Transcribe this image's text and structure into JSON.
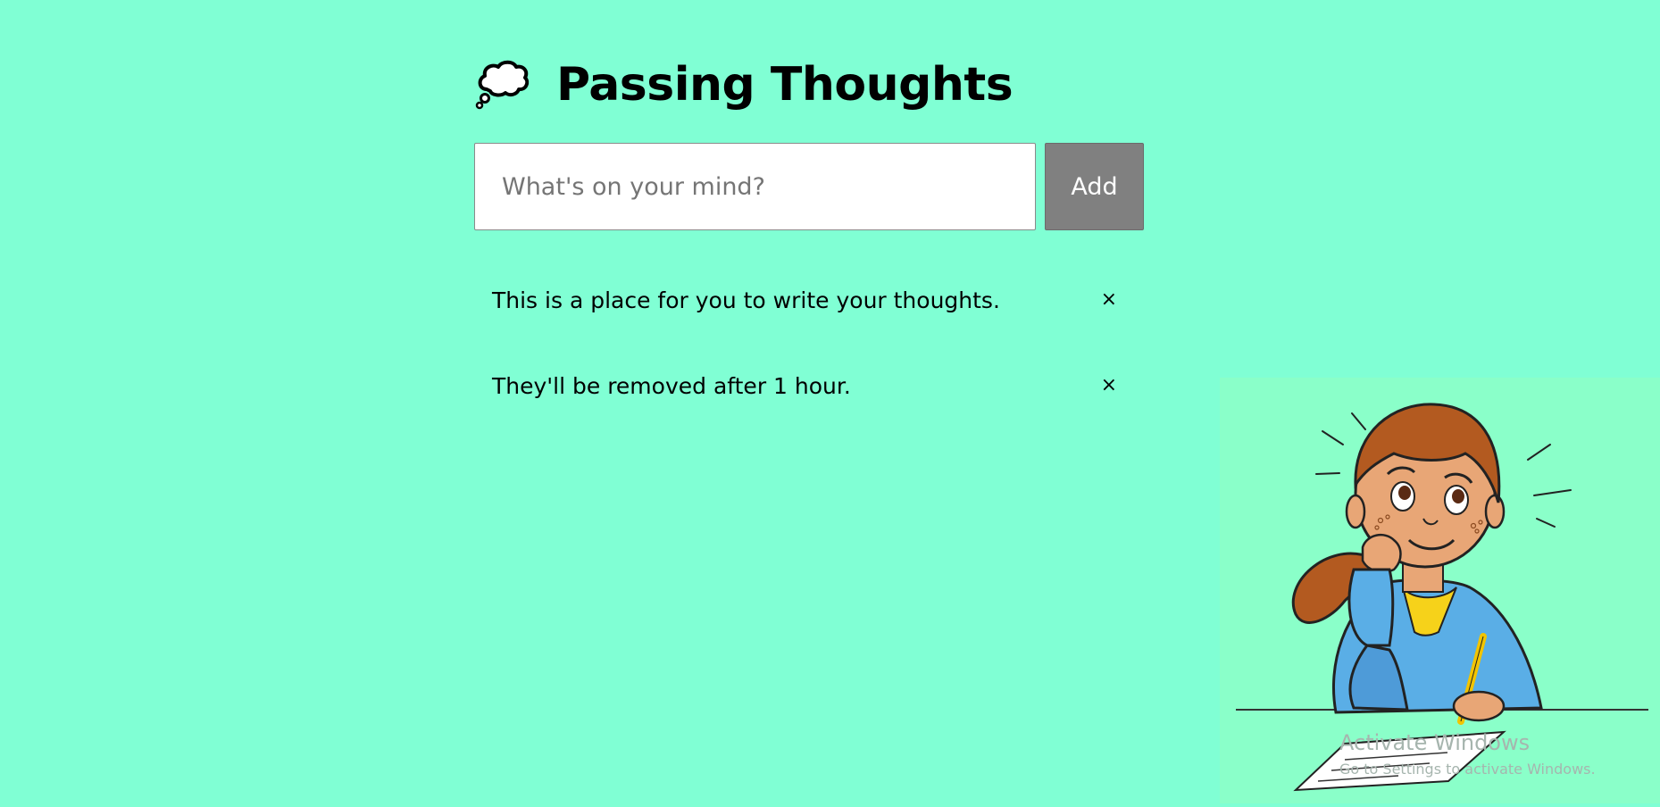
{
  "header": {
    "icon": "thought-bubble-icon",
    "title": "Passing Thoughts"
  },
  "form": {
    "placeholder": "What's on your mind?",
    "value": "",
    "add_label": "Add"
  },
  "thoughts": [
    {
      "text": "This is a place for you to write your thoughts.",
      "remove_symbol": "×"
    },
    {
      "text": "They'll be removed after 1 hour.",
      "remove_symbol": "×"
    }
  ],
  "illustration": {
    "subject": "girl-thinking-at-desk-illustration"
  },
  "watermark": {
    "title": "Activate Windows",
    "subtitle": "Go to Settings to activate Windows."
  },
  "colors": {
    "background": "#80ffd4",
    "button": "#808080",
    "button_text": "#ffffff",
    "input_bg": "#ffffff",
    "hoodie": "#5aaee6",
    "hair": "#b35a20",
    "skin": "#e8a676"
  }
}
